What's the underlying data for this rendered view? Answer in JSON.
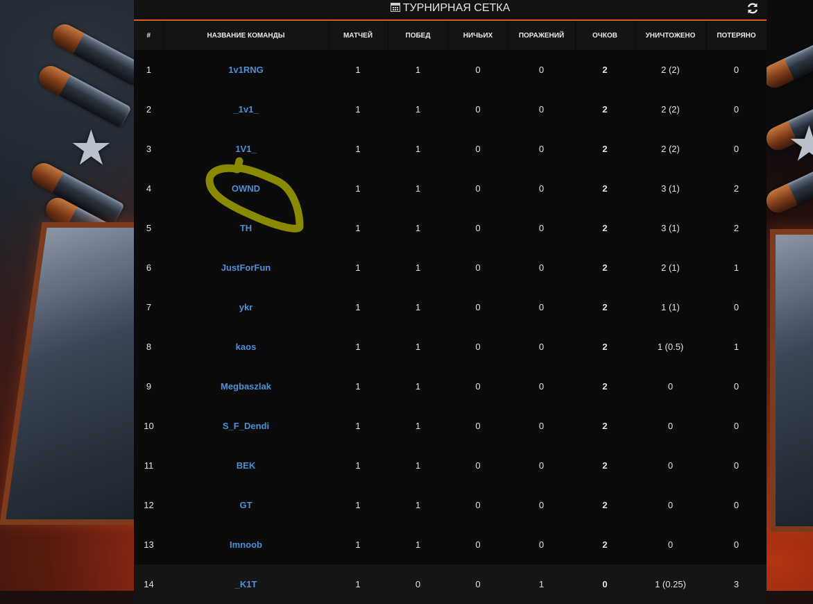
{
  "header": {
    "title": "ТУРНИРНАЯ СЕТКА",
    "title_icon": "calendar-icon",
    "refresh_icon": "refresh-icon"
  },
  "table": {
    "columns": [
      "#",
      "НАЗВАНИЕ КОМАНДЫ",
      "МАТЧЕЙ",
      "ПОБЕД",
      "НИЧЬИХ",
      "ПОРАЖЕНИЙ",
      "ОЧКОВ",
      "УНИЧТОЖЕНО",
      "ПОТЕРЯНО"
    ],
    "rows": [
      {
        "rank": "1",
        "team": "1v1RNG",
        "matches": "1",
        "wins": "1",
        "draws": "0",
        "losses": "0",
        "points": "2",
        "destroyed": "2 (2)",
        "lost": "0"
      },
      {
        "rank": "2",
        "team": "_1v1_",
        "matches": "1",
        "wins": "1",
        "draws": "0",
        "losses": "0",
        "points": "2",
        "destroyed": "2 (2)",
        "lost": "0"
      },
      {
        "rank": "3",
        "team": "1V1_",
        "matches": "1",
        "wins": "1",
        "draws": "0",
        "losses": "0",
        "points": "2",
        "destroyed": "2 (2)",
        "lost": "0"
      },
      {
        "rank": "4",
        "team": "OWND",
        "matches": "1",
        "wins": "1",
        "draws": "0",
        "losses": "0",
        "points": "2",
        "destroyed": "3 (1)",
        "lost": "2"
      },
      {
        "rank": "5",
        "team": "TH",
        "matches": "1",
        "wins": "1",
        "draws": "0",
        "losses": "0",
        "points": "2",
        "destroyed": "3 (1)",
        "lost": "2"
      },
      {
        "rank": "6",
        "team": "JustForFun",
        "matches": "1",
        "wins": "1",
        "draws": "0",
        "losses": "0",
        "points": "2",
        "destroyed": "2 (1)",
        "lost": "1"
      },
      {
        "rank": "7",
        "team": "ykr",
        "matches": "1",
        "wins": "1",
        "draws": "0",
        "losses": "0",
        "points": "2",
        "destroyed": "1 (1)",
        "lost": "0"
      },
      {
        "rank": "8",
        "team": "kaos",
        "matches": "1",
        "wins": "1",
        "draws": "0",
        "losses": "0",
        "points": "2",
        "destroyed": "1 (0.5)",
        "lost": "1"
      },
      {
        "rank": "9",
        "team": "Megbaszlak",
        "matches": "1",
        "wins": "1",
        "draws": "0",
        "losses": "0",
        "points": "2",
        "destroyed": "0",
        "lost": "0"
      },
      {
        "rank": "10",
        "team": "S_F_Dendi",
        "matches": "1",
        "wins": "1",
        "draws": "0",
        "losses": "0",
        "points": "2",
        "destroyed": "0",
        "lost": "0"
      },
      {
        "rank": "11",
        "team": "BEK",
        "matches": "1",
        "wins": "1",
        "draws": "0",
        "losses": "0",
        "points": "2",
        "destroyed": "0",
        "lost": "0"
      },
      {
        "rank": "12",
        "team": "GT",
        "matches": "1",
        "wins": "1",
        "draws": "0",
        "losses": "0",
        "points": "2",
        "destroyed": "0",
        "lost": "0"
      },
      {
        "rank": "13",
        "team": "Imnoob",
        "matches": "1",
        "wins": "1",
        "draws": "0",
        "losses": "0",
        "points": "2",
        "destroyed": "0",
        "lost": "0"
      },
      {
        "rank": "14",
        "team": "_K1T",
        "matches": "1",
        "wins": "0",
        "draws": "0",
        "losses": "1",
        "points": "0",
        "destroyed": "1 (0.25)",
        "lost": "3"
      }
    ]
  },
  "colors": {
    "accent": "#e05a1a",
    "team_link": "#4f8fd6",
    "annotation": "#8a8a00"
  }
}
